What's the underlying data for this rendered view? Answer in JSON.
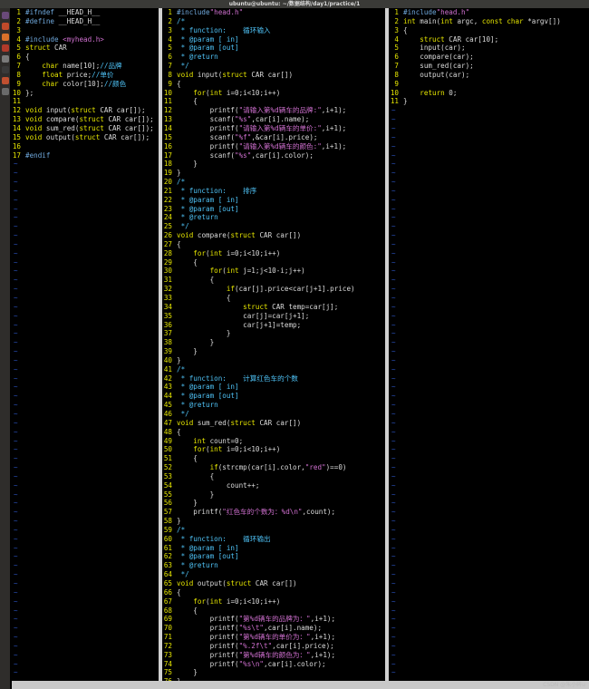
{
  "window": {
    "title": "ubuntu@ubuntu: ~/数据结构/day1/practice/1"
  },
  "launcher": {
    "icons": [
      "dash-icon",
      "files-icon",
      "firefox-icon",
      "software-icon",
      "settings-icon",
      "terminal-icon",
      "update-icon",
      "disk-icon"
    ]
  },
  "watermark": "CSDN @朱小碎u",
  "colors": {
    "background": "#000000",
    "line_number": "#e6e600",
    "keyword": "#e6e600",
    "preprocessor": "#6fa8dc",
    "string": "#d070d0",
    "comment": "#4fc3f7",
    "tilde": "#2a52be",
    "text": "#dcdcdc"
  },
  "panes": [
    {
      "name": "head-h",
      "lines": [
        "#ifndef __HEAD_H__",
        "#define __HEAD_H__",
        "",
        "#include <myhead.h>",
        "struct CAR",
        "{",
        "    char name[10];//品牌",
        "    float price;//单价",
        "    char color[10];//颜色",
        "};",
        "",
        "void input(struct CAR car[]);",
        "void compare(struct CAR car[]);",
        "void sum_red(struct CAR car[]);",
        "void output(struct CAR car[]);",
        "",
        "#endif"
      ],
      "tildes": 59
    },
    {
      "name": "test-c",
      "lines": [
        "#include\"head.h\"",
        "/*",
        " * function:    循环输入",
        " * @param [ in]",
        " * @param [out]",
        " * @return",
        " */",
        "void input(struct CAR car[])",
        "{",
        "    for(int i=0;i<10;i++)",
        "    {",
        "        printf(\"请输入第%d辆车的品牌:\",i+1);",
        "        scanf(\"%s\",car[i].name);",
        "        printf(\"请输入第%d辆车的单价:\",i+1);",
        "        scanf(\"%f\",&car[i].price);",
        "        printf(\"请输入第%d辆车的颜色:\",i+1);",
        "        scanf(\"%s\",car[i].color);",
        "    }",
        "}",
        "/*",
        " * function:    排序",
        " * @param [ in]",
        " * @param [out]",
        " * @return",
        " */",
        "void compare(struct CAR car[])",
        "{",
        "    for(int i=0;i<10;i++)",
        "    {",
        "        for(int j=1;j<10-i;j++)",
        "        {",
        "            if(car[j].price<car[j+1].price)",
        "            {",
        "                struct CAR temp=car[j];",
        "                car[j]=car[j+1];",
        "                car[j+1]=temp;",
        "            }",
        "        }",
        "    }",
        "}",
        "/*",
        " * function:    计算红色车的个数",
        " * @param [ in]",
        " * @param [out]",
        " * @return",
        " */",
        "void sum_red(struct CAR car[])",
        "{",
        "    int count=0;",
        "    for(int i=0;i<10;i++)",
        "    {",
        "        if(strcmp(car[i].color,\"red\")==0)",
        "        {",
        "            count++;",
        "        }",
        "    }",
        "    printf(\"红色车的个数为：%d\\n\",count);",
        "}",
        "/*",
        " * function:    循环输出",
        " * @param [ in]",
        " * @param [out]",
        " * @return",
        " */",
        "void output(struct CAR car[])",
        "{",
        "    for(int i=0;i<10;i++)",
        "    {",
        "        printf(\"第%d辆车的品牌为：\",i+1);",
        "        printf(\"%s\\t\",car[i].name);",
        "        printf(\"第%d辆车的单价为：\",i+1);",
        "        printf(\"%.2f\\t\",car[i].price);",
        "        printf(\"第%d辆车的颜色为：\",i+1);",
        "        printf(\"%s\\n\",car[i].color);",
        "    }",
        "}",
        "",
        ""
      ],
      "tildes": 0
    },
    {
      "name": "main-c",
      "lines": [
        "#include\"head.h\"",
        "int main(int argc, const char *argv[])",
        "{",
        "    struct CAR car[10];",
        "    input(car);",
        "    compare(car);",
        "    sum_red(car);",
        "    output(car);",
        "",
        "    return 0;",
        "}"
      ],
      "tildes": 65
    }
  ]
}
